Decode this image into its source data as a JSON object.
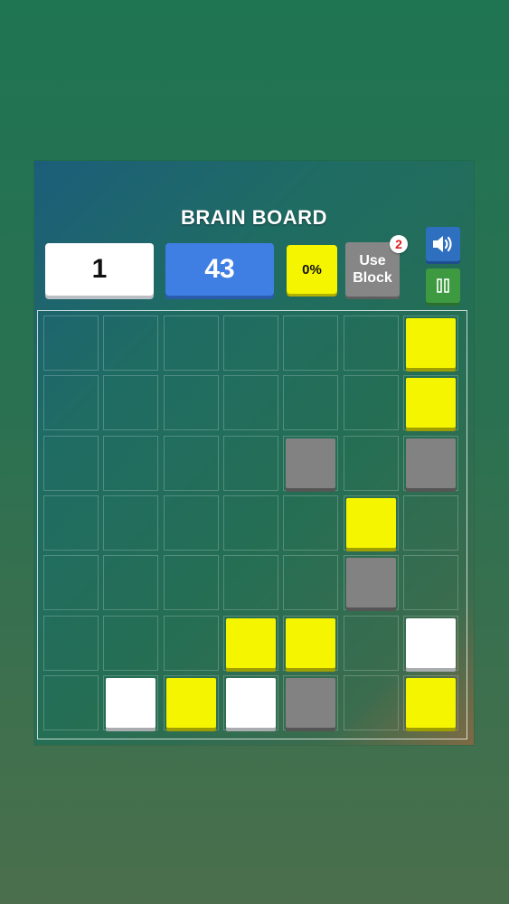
{
  "game": {
    "title": "BRAIN BOARD",
    "level": "1",
    "moves": "43",
    "percent": "0%",
    "use_block": {
      "line1": "Use",
      "line2": "Block",
      "count": "2"
    },
    "sound_icon": "speaker-icon",
    "pause_icon": "pause-icon"
  },
  "colors": {
    "yellow": "#f5f500",
    "gray": "#828282",
    "white": "#ffffff",
    "level_box": "#ffffff",
    "moves_box": "#3f7fe3",
    "sound_button": "#2f6fbf",
    "pause_button": "#3e9a40",
    "badge_text": "#e02020"
  },
  "board": {
    "rows": 7,
    "cols": 7,
    "tiles": [
      {
        "row": 0,
        "col": 6,
        "color": "yellow"
      },
      {
        "row": 1,
        "col": 6,
        "color": "yellow"
      },
      {
        "row": 2,
        "col": 4,
        "color": "gray"
      },
      {
        "row": 2,
        "col": 6,
        "color": "gray"
      },
      {
        "row": 3,
        "col": 5,
        "color": "yellow"
      },
      {
        "row": 4,
        "col": 5,
        "color": "gray"
      },
      {
        "row": 5,
        "col": 3,
        "color": "yellow"
      },
      {
        "row": 5,
        "col": 4,
        "color": "yellow"
      },
      {
        "row": 5,
        "col": 6,
        "color": "white"
      },
      {
        "row": 6,
        "col": 1,
        "color": "white"
      },
      {
        "row": 6,
        "col": 2,
        "color": "yellow"
      },
      {
        "row": 6,
        "col": 3,
        "color": "white"
      },
      {
        "row": 6,
        "col": 4,
        "color": "gray"
      },
      {
        "row": 6,
        "col": 6,
        "color": "yellow"
      }
    ]
  }
}
